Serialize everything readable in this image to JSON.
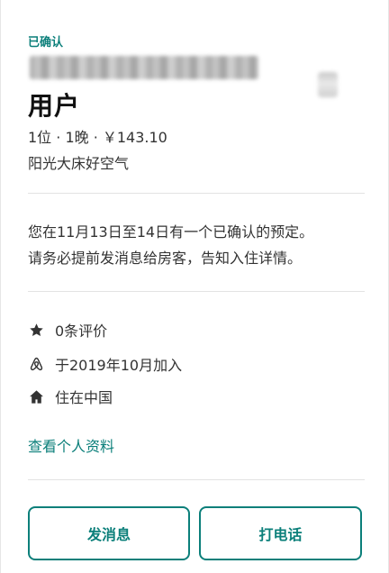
{
  "reservation": {
    "status": "已确认",
    "host_name": "用户",
    "stay_info": "1位 · 1晚 · ￥143.10",
    "listing_name": "阳光大床好空气"
  },
  "message": {
    "line1": "您在11月13日至14日有一个已确认的预定。",
    "line2": "请务必提前发消息给房客，告知入住详情。"
  },
  "details": {
    "reviews": {
      "icon": "star-icon",
      "text": "0条评价"
    },
    "joined": {
      "icon": "airbnb-logo-icon",
      "text": "于2019年10月加入"
    },
    "location": {
      "icon": "home-icon",
      "text": "住在中国"
    }
  },
  "profile_link": "查看个人资料",
  "actions": {
    "message_label": "发消息",
    "call_label": "打电话"
  },
  "colors": {
    "accent": "#0b7f7a",
    "text": "#333333",
    "divider": "#e3e3e3"
  }
}
